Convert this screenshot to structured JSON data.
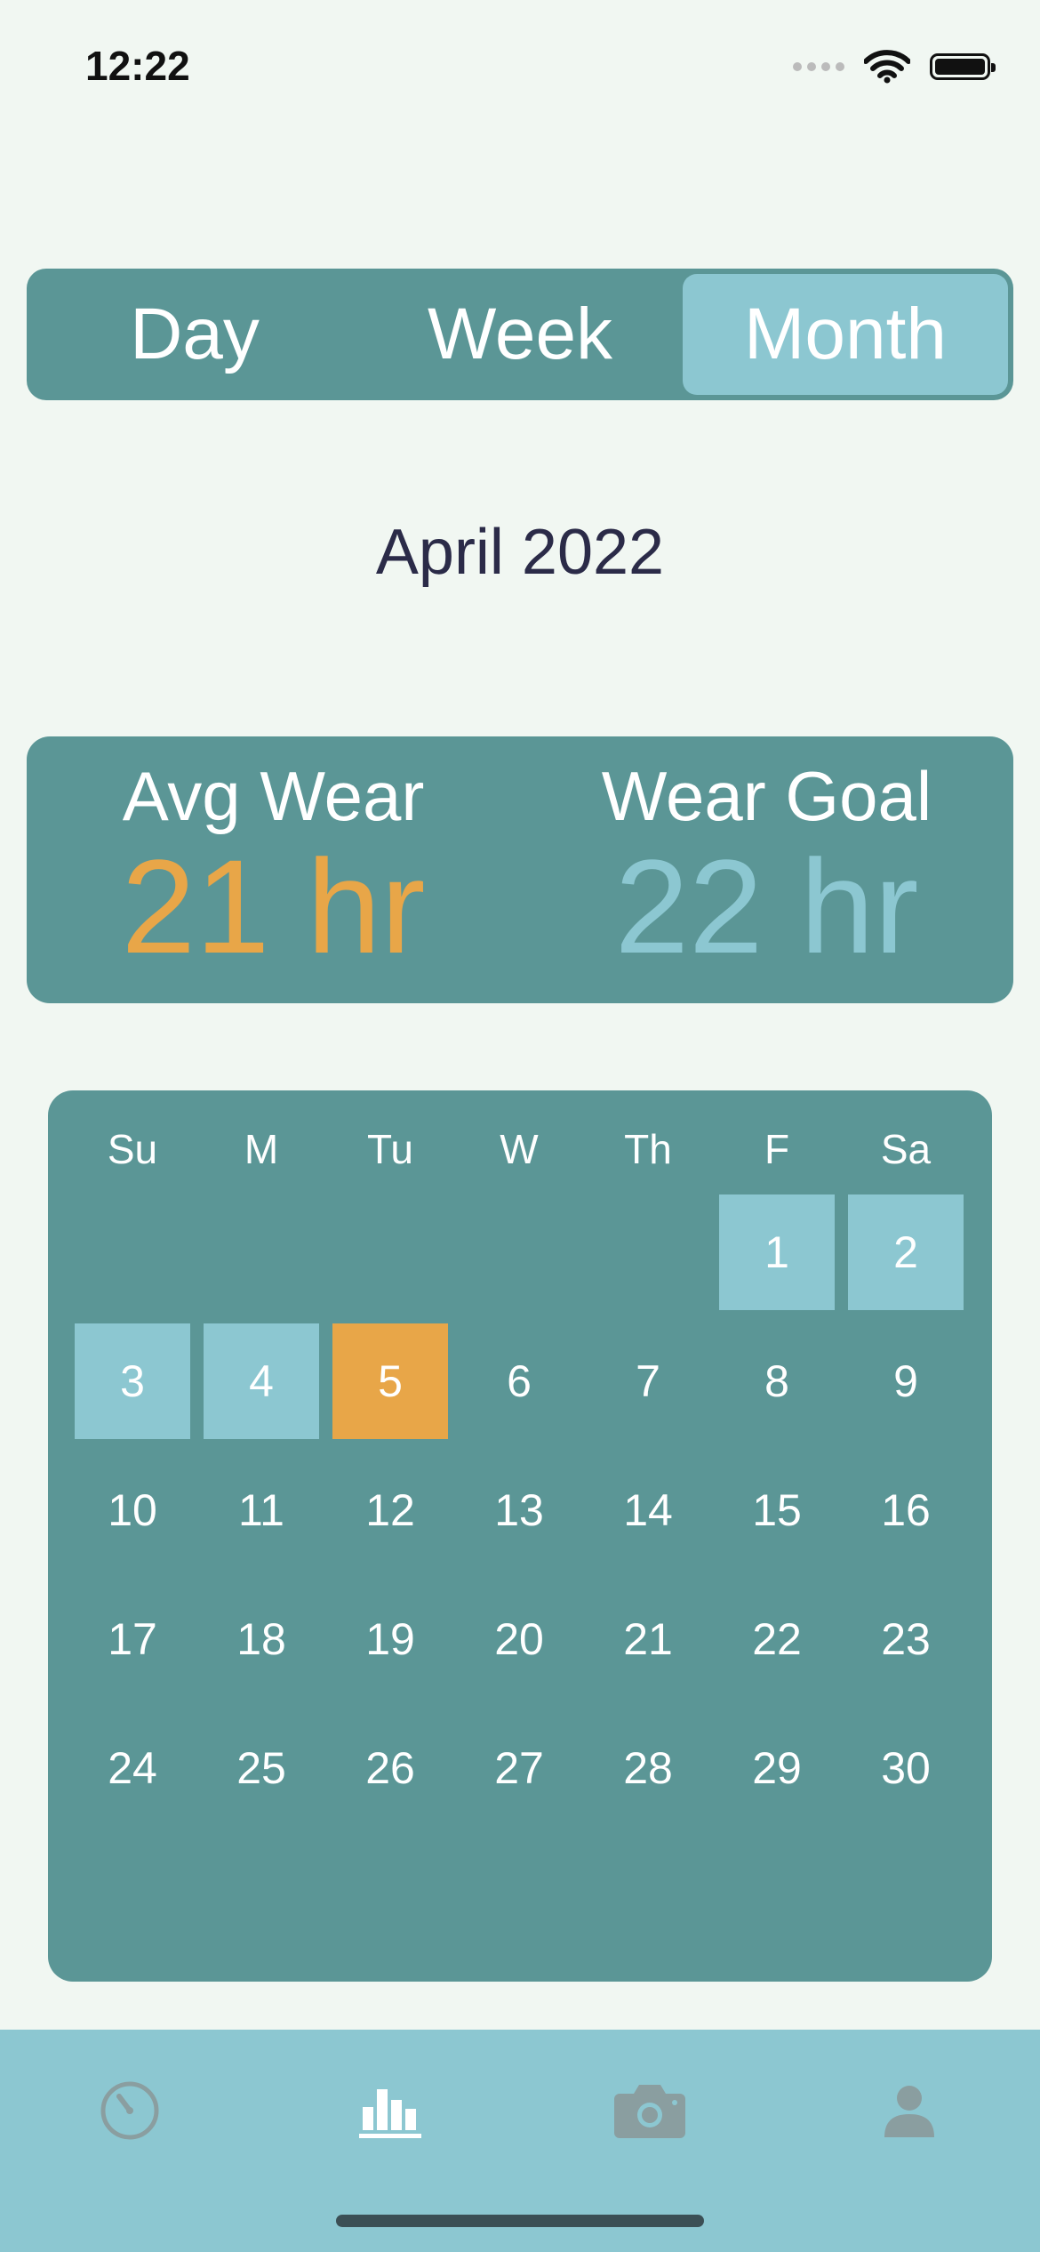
{
  "status_bar": {
    "time": "12:22"
  },
  "segmented": {
    "options": [
      {
        "label": "Day",
        "active": false
      },
      {
        "label": "Week",
        "active": false
      },
      {
        "label": "Month",
        "active": true
      }
    ]
  },
  "month_title": "April 2022",
  "stats": {
    "avg_label": "Avg Wear",
    "avg_value": "21 hr",
    "goal_label": "Wear Goal",
    "goal_value": "22 hr"
  },
  "calendar": {
    "weekdays": [
      "Su",
      "M",
      "Tu",
      "W",
      "Th",
      "F",
      "Sa"
    ],
    "leading_blanks": 5,
    "days": [
      "1",
      "2",
      "3",
      "4",
      "5",
      "6",
      "7",
      "8",
      "9",
      "10",
      "11",
      "12",
      "13",
      "14",
      "15",
      "16",
      "17",
      "18",
      "19",
      "20",
      "21",
      "22",
      "23",
      "24",
      "25",
      "26",
      "27",
      "28",
      "29",
      "30"
    ],
    "worn_days": [
      "1",
      "2",
      "3",
      "4"
    ],
    "today": "5"
  },
  "colors": {
    "background": "#f1f7f2",
    "card": "#5b9696",
    "accent_light": "#8cc7d1",
    "accent_orange": "#e8a648",
    "title_text": "#2b2b48"
  },
  "tabbar": {
    "icons": [
      "timer-icon",
      "bar-chart-icon",
      "camera-icon",
      "person-icon"
    ],
    "active": "bar-chart-icon"
  }
}
